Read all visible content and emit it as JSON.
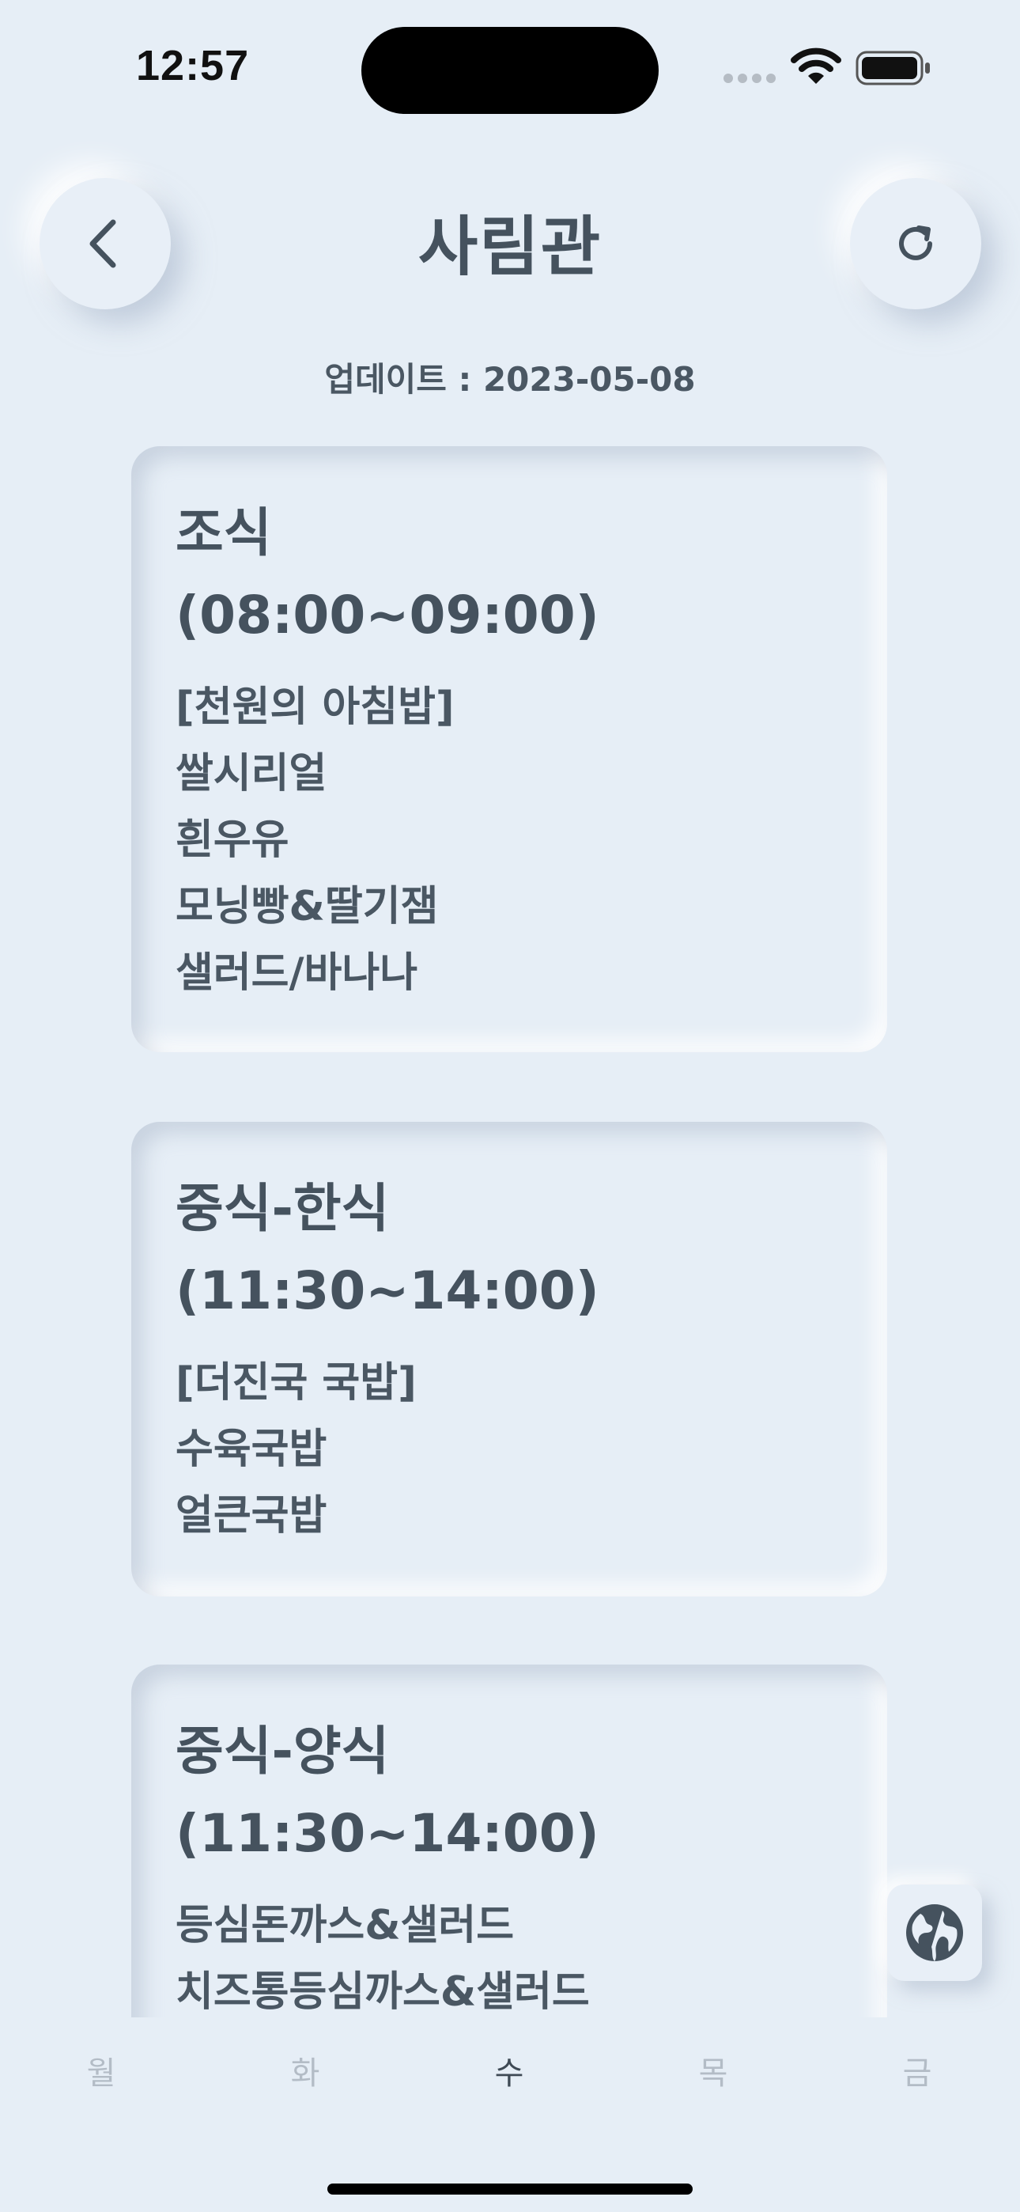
{
  "status_bar": {
    "time": "12:57"
  },
  "header": {
    "title": "사림관",
    "back_icon": "chevron-left-icon",
    "refresh_icon": "refresh-icon"
  },
  "update": {
    "text": "업데이트 : 2023-05-08"
  },
  "meals": [
    {
      "title": "조식",
      "time": "(08:00~09:00)",
      "items": [
        "[천원의 아침밥]",
        "쌀시리얼",
        "흰우유",
        "모닝빵&딸기잼",
        "샐러드/바나나"
      ]
    },
    {
      "title": "중식-한식",
      "time": "(11:30~14:00)",
      "items": [
        "[더진국 국밥]",
        "수육국밥",
        "얼큰국밥"
      ]
    },
    {
      "title": "중식-양식",
      "time": "(11:30~14:00)",
      "items": [
        "등심돈까스&샐러드",
        "치즈통등심까스&샐러드"
      ]
    }
  ],
  "floating": {
    "icon": "globe-icon"
  },
  "day_tabs": [
    {
      "label": "월",
      "active": false
    },
    {
      "label": "화",
      "active": false
    },
    {
      "label": "수",
      "active": true
    },
    {
      "label": "목",
      "active": false
    },
    {
      "label": "금",
      "active": false
    }
  ],
  "colors": {
    "background": "#e6eef6",
    "text": "#45525e",
    "inactive_tab": "#b3bcc6"
  }
}
